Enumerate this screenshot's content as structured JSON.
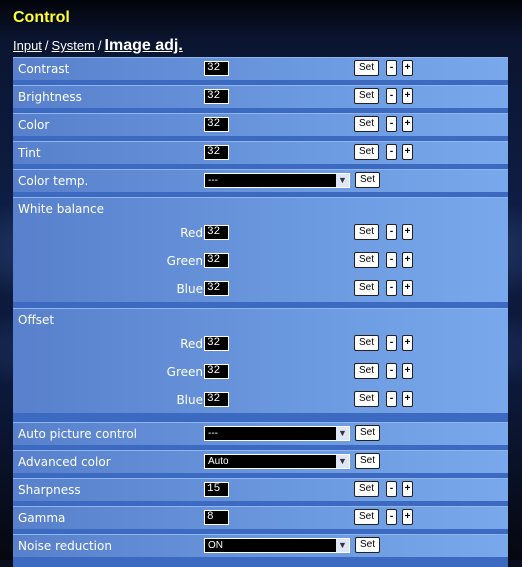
{
  "header": {
    "title": "Control"
  },
  "breadcrumb": {
    "input": "Input",
    "system": "System",
    "current": "Image adj.",
    "sep": "/"
  },
  "buttons": {
    "set": "Set",
    "minus": "-",
    "plus": "+"
  },
  "rows": {
    "contrast": {
      "label": "Contrast",
      "value": "32"
    },
    "brightness": {
      "label": "Brightness",
      "value": "32"
    },
    "color": {
      "label": "Color",
      "value": "32"
    },
    "tint": {
      "label": "Tint",
      "value": "32"
    },
    "color_temp": {
      "label": "Color temp.",
      "selected": "---"
    },
    "white_balance": {
      "label": "White balance",
      "red": {
        "label": "Red",
        "value": "32"
      },
      "green": {
        "label": "Green",
        "value": "32"
      },
      "blue": {
        "label": "Blue",
        "value": "32"
      }
    },
    "offset": {
      "label": "Offset",
      "red": {
        "label": "Red",
        "value": "32"
      },
      "green": {
        "label": "Green",
        "value": "32"
      },
      "blue": {
        "label": "Blue",
        "value": "32"
      }
    },
    "auto_picture": {
      "label": "Auto picture control",
      "selected": "---"
    },
    "advanced_color": {
      "label": "Advanced color",
      "selected": "Auto"
    },
    "sharpness": {
      "label": "Sharpness",
      "value": "15"
    },
    "gamma": {
      "label": "Gamma",
      "value": "8"
    },
    "noise_reduction": {
      "label": "Noise reduction",
      "selected": "ON"
    }
  },
  "colors": {
    "title": "#ffff33",
    "panel": "#3c6ac0",
    "row": "#6c9ae0"
  }
}
